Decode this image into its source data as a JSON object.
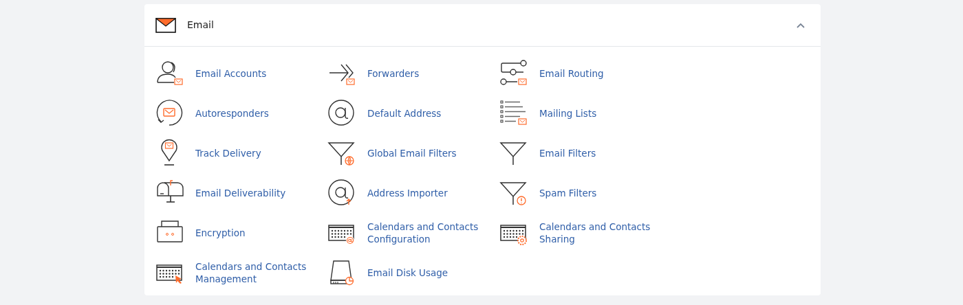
{
  "section": {
    "title": "Email",
    "expanded": true
  },
  "rows": [
    [
      {
        "label": "Email Accounts"
      },
      {
        "label": "Forwarders"
      },
      {
        "label": "Email Routing"
      }
    ],
    [
      {
        "label": "Autoresponders"
      },
      {
        "label": "Default Address"
      },
      {
        "label": "Mailing Lists"
      }
    ],
    [
      {
        "label": "Track Delivery"
      },
      {
        "label": "Global Email Filters"
      },
      {
        "label": "Email Filters"
      }
    ],
    [
      {
        "label": "Email Deliverability"
      },
      {
        "label": "Address Importer"
      },
      {
        "label": "Spam Filters"
      }
    ],
    [
      {
        "label": "Encryption"
      },
      {
        "label": "Calendars and Contacts Configuration"
      },
      {
        "label": "Calendars and Contacts Sharing"
      }
    ],
    [
      {
        "label": "Calendars and Contacts Management"
      },
      {
        "label": "Email Disk Usage"
      }
    ]
  ]
}
